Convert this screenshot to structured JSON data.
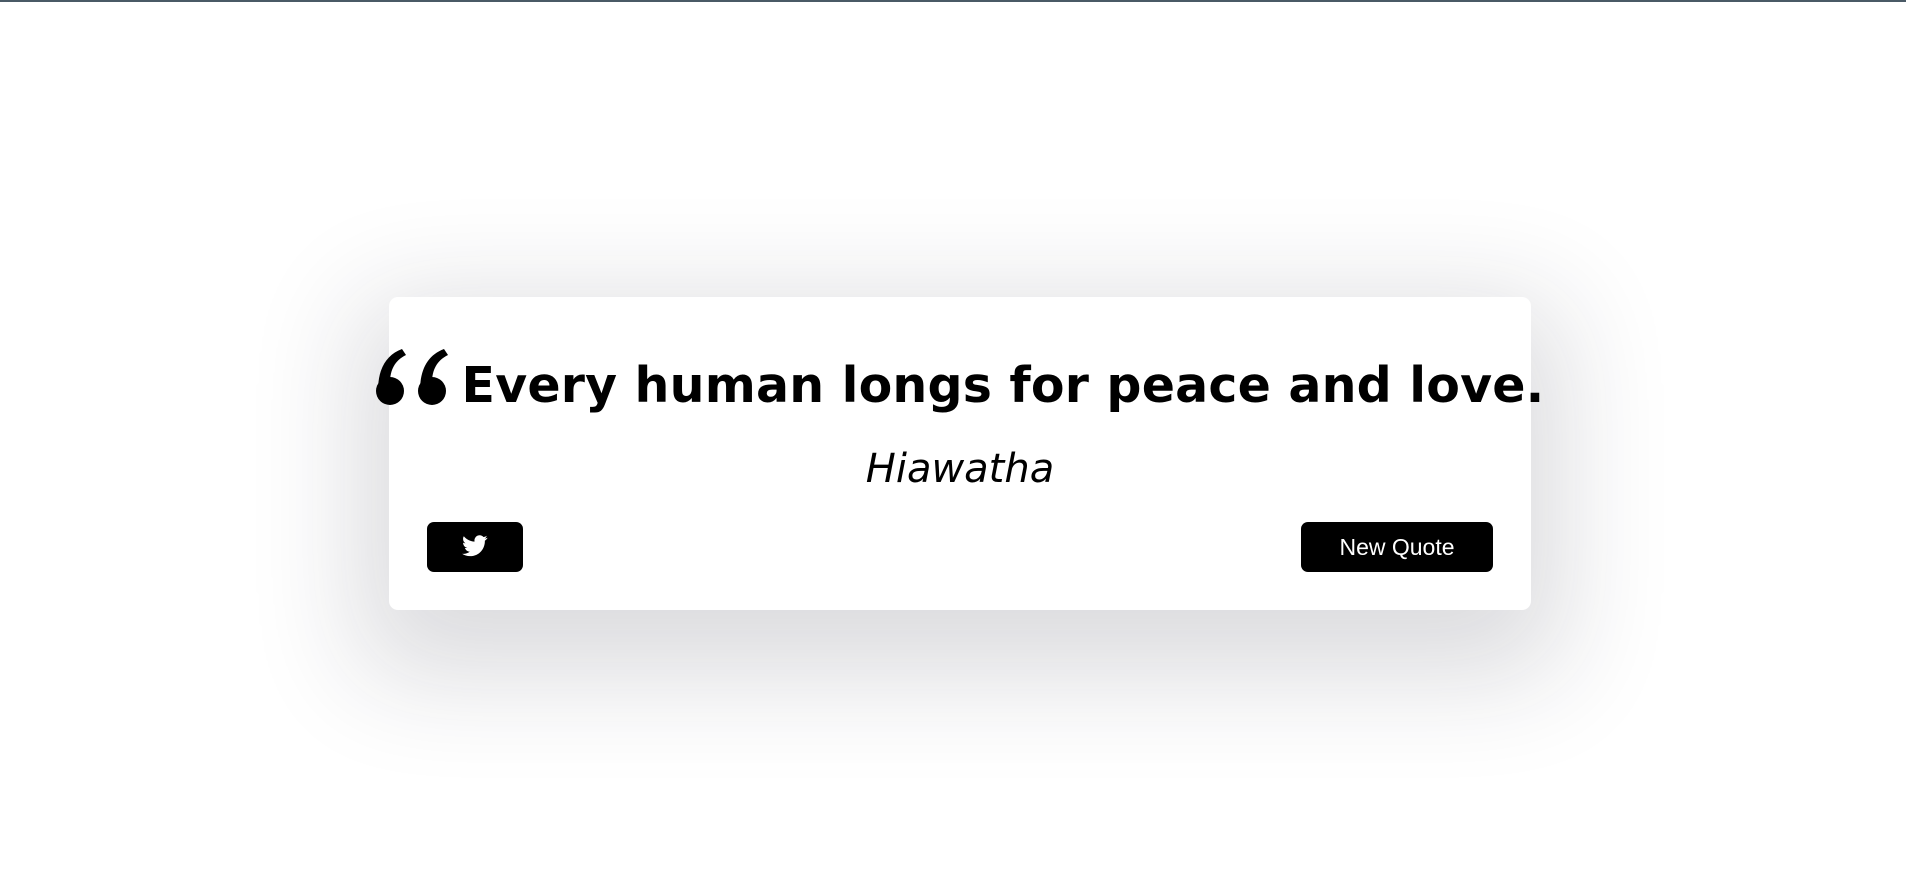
{
  "quote": {
    "text": "Every human longs for peace and love.",
    "author": "Hiawatha",
    "quote_icon": "quote-left-icon"
  },
  "actions": {
    "twitter_icon": "twitter-icon",
    "new_quote_label": "New Quote"
  },
  "colors": {
    "background": "#ffffff",
    "card": "#ffffff",
    "button": "#000000",
    "button_text": "#ffffff",
    "text": "#000000",
    "top_border": "#4a5a66"
  }
}
